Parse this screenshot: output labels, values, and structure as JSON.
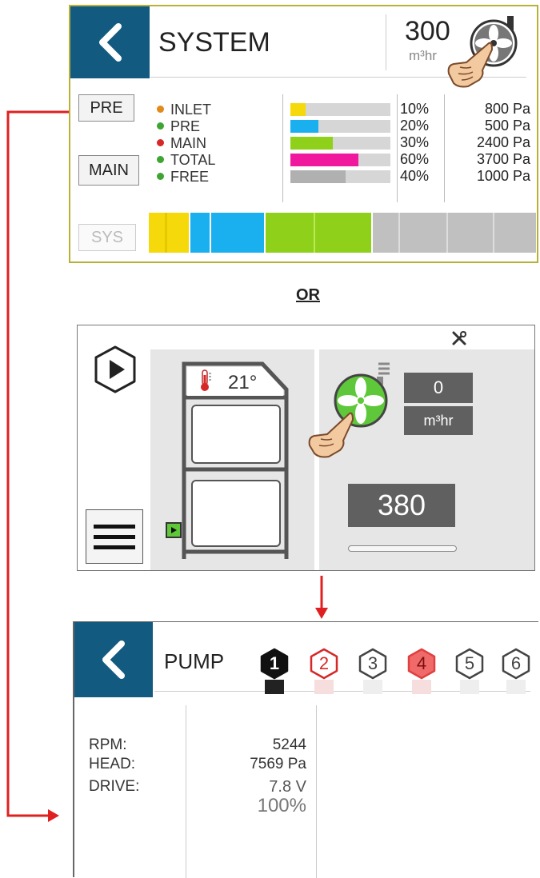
{
  "system_panel": {
    "title": "SYSTEM",
    "airflow_value": "300",
    "airflow_unit": "m³hr",
    "buttons": {
      "pre": "PRE",
      "main": "MAIN",
      "sys": "SYS"
    },
    "rows": [
      {
        "label": "INLET",
        "dot_color": "#e08a1a",
        "bar_color": "#f5d90a",
        "fill": 0.15,
        "percent": "10%",
        "pressure": "800 Pa"
      },
      {
        "label": "PRE",
        "dot_color": "#3fa532",
        "bar_color": "#1ab0f0",
        "fill": 0.28,
        "percent": "20%",
        "pressure": "500 Pa"
      },
      {
        "label": "MAIN",
        "dot_color": "#d62828",
        "bar_color": "#8fd11a",
        "fill": 0.42,
        "percent": "30%",
        "pressure": "2400 Pa"
      },
      {
        "label": "TOTAL",
        "dot_color": "#3fa532",
        "bar_color": "#f0189c",
        "fill": 0.68,
        "percent": "60%",
        "pressure": "3700 Pa"
      },
      {
        "label": "FREE",
        "dot_color": "#3fa532",
        "bar_color": "#b0b0b0",
        "fill": 0.55,
        "percent": "40%",
        "pressure": "1000 Pa"
      }
    ]
  },
  "separator_text": "OR",
  "home_panel": {
    "temperature": "21°",
    "fan_value": "0",
    "fan_unit": "m³hr",
    "setpoint": "380"
  },
  "pump_panel": {
    "title": "PUMP",
    "pumps": [
      {
        "label": "1",
        "state": "selected"
      },
      {
        "label": "2",
        "state": "alarm-outline"
      },
      {
        "label": "3",
        "state": "normal"
      },
      {
        "label": "4",
        "state": "alarm"
      },
      {
        "label": "5",
        "state": "normal"
      },
      {
        "label": "6",
        "state": "normal"
      }
    ],
    "labels": {
      "rpm": "RPM:",
      "head": "HEAD:",
      "drive": "DRIVE:"
    },
    "values": {
      "rpm": "5244",
      "head": "7569 Pa",
      "drive": "7.8 V",
      "percent": "100%"
    }
  },
  "colors": {
    "brand_blue": "#125a80",
    "arrow_red": "#e02020",
    "fan_green": "#5fc83a"
  }
}
